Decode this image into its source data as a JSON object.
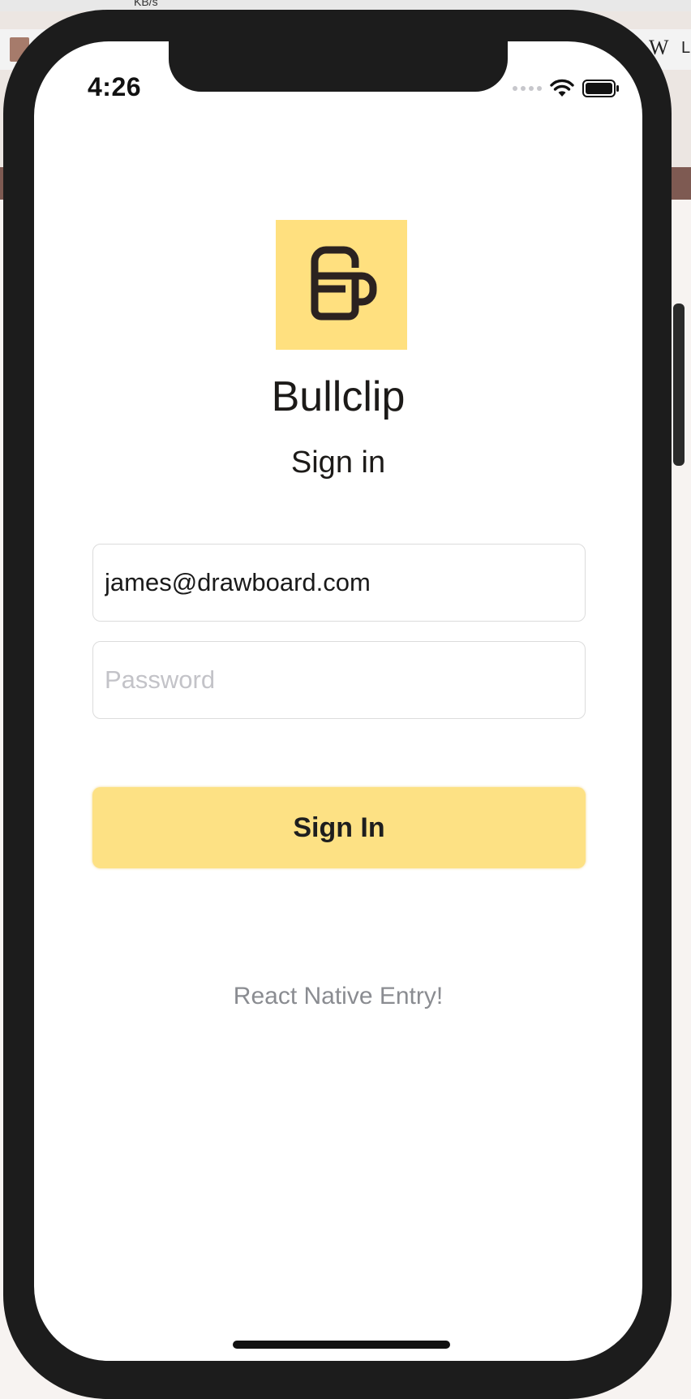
{
  "status_bar": {
    "time": "4:26"
  },
  "app": {
    "name": "Bullclip",
    "subtitle": "Sign in",
    "logo_icon": "bullclip-logo-icon",
    "accent_color": "#ffe07f"
  },
  "form": {
    "email_value": "james@drawboard.com",
    "password_value": "",
    "password_placeholder": "Password",
    "submit_label": "Sign In"
  },
  "footer": {
    "text": "React Native Entry!"
  },
  "background": {
    "window_top_text": "KB/s"
  }
}
